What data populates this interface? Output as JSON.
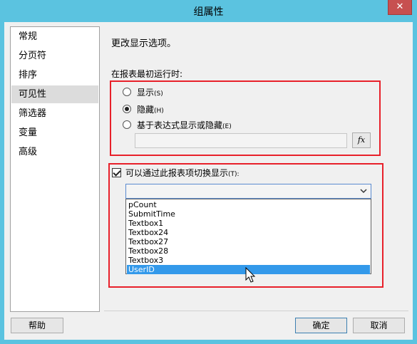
{
  "window": {
    "title": "组属性",
    "close_glyph": "✕"
  },
  "nav": {
    "items": [
      {
        "label": "常规",
        "selected": false
      },
      {
        "label": "分页符",
        "selected": false
      },
      {
        "label": "排序",
        "selected": false
      },
      {
        "label": "可见性",
        "selected": true
      },
      {
        "label": "筛选器",
        "selected": false
      },
      {
        "label": "变量",
        "selected": false
      },
      {
        "label": "高级",
        "selected": false
      }
    ]
  },
  "main": {
    "heading": "更改显示选项。",
    "initial_label": "在报表最初运行时:",
    "radios": [
      {
        "label": "显示",
        "accel": "(S)",
        "checked": false
      },
      {
        "label": "隐藏",
        "accel": "(H)",
        "checked": true
      },
      {
        "label": "基于表达式显示或隐藏",
        "accel": "(E)",
        "checked": false
      }
    ],
    "expression_value": "",
    "fx_label": "fx",
    "toggle": {
      "label": "可以通过此报表项切换显示",
      "accel": "(T):",
      "checked": true
    },
    "dropdown": {
      "selected_value": "",
      "options": [
        "pCount",
        "SubmitTime",
        "Textbox1",
        "Textbox24",
        "Textbox27",
        "Textbox28",
        "Textbox3",
        "UserID"
      ],
      "highlighted": "UserID"
    }
  },
  "footer": {
    "help_label": "帮助",
    "ok_label": "确定",
    "cancel_label": "取消"
  },
  "colors": {
    "title_bar": "#5bc3e0",
    "highlight_box": "#e8202a",
    "selection": "#3399ea"
  }
}
